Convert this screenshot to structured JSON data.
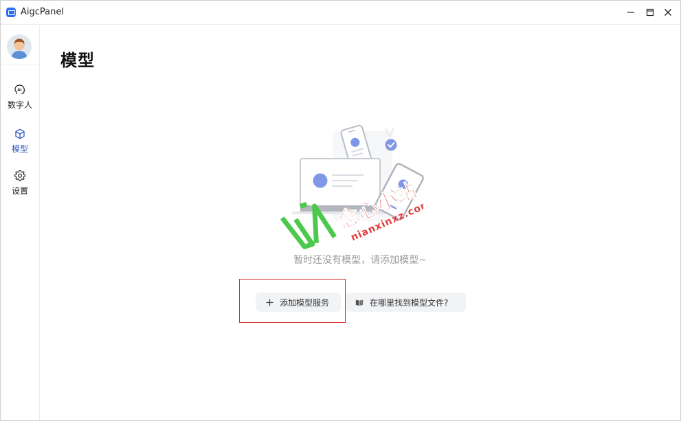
{
  "window": {
    "title": "AigcPanel",
    "controls": {
      "minimize": "minimize-icon",
      "maximize": "maximize-icon",
      "close": "close-icon"
    }
  },
  "sidebar": {
    "avatar": "user-avatar",
    "items": [
      {
        "label": "数字人",
        "icon": "ai-head-icon",
        "active": false
      },
      {
        "label": "模型",
        "icon": "cube-icon",
        "active": true
      },
      {
        "label": "设置",
        "icon": "gear-icon",
        "active": false
      }
    ]
  },
  "main": {
    "title": "模型",
    "empty_state": {
      "message": "暂时还没有模型，请添加模型~",
      "illustration": "empty-devices-illustration"
    },
    "actions": {
      "add_label": "添加模型服务",
      "add_icon": "plus-icon",
      "where_label": "在哪里找到模型文件?",
      "where_icon": "book-icon"
    }
  },
  "watermark": {
    "brand": "念心小站",
    "url": "nianxinxz.com"
  },
  "colors": {
    "accent": "#2f56c6",
    "highlight_border": "#d62a2a",
    "watermark_red": "#e23b3b",
    "watermark_green": "#4cc94c"
  }
}
